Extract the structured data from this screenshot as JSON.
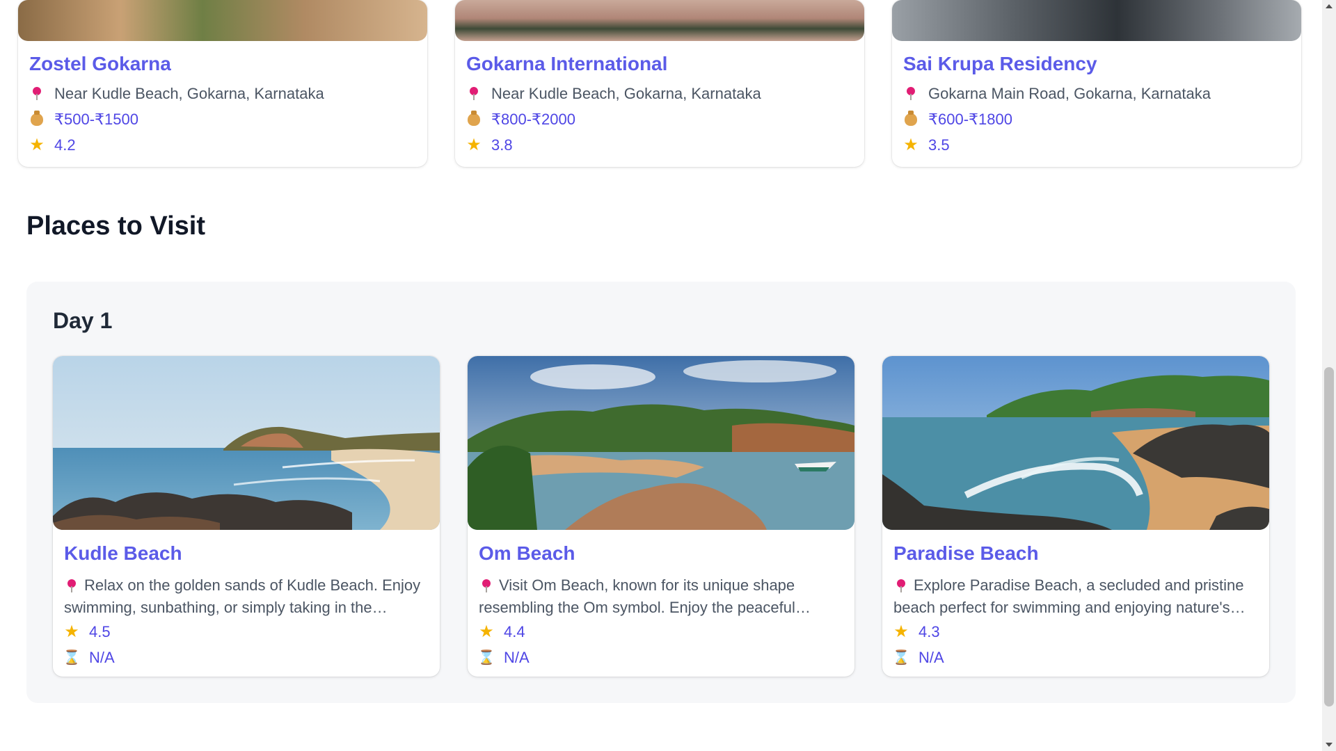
{
  "hotels": [
    {
      "name": "Zostel Gokarna",
      "location": "Near Kudle Beach, Gokarna, Karnataka",
      "price": "₹500-₹1500",
      "rating": "4.2"
    },
    {
      "name": "Gokarna International",
      "location": "Near Kudle Beach, Gokarna, Karnataka",
      "price": "₹800-₹2000",
      "rating": "3.8"
    },
    {
      "name": "Sai Krupa Residency",
      "location": "Gokarna Main Road, Gokarna, Karnataka",
      "price": "₹600-₹1800",
      "rating": "3.5"
    }
  ],
  "places_section_title": "Places to Visit",
  "day": {
    "title": "Day 1",
    "places": [
      {
        "name": "Kudle Beach",
        "description": "Relax on the golden sands of Kudle Beach. Enjoy swimming, sunbathing, or simply taking in the breathtaking views of the Arabian Sea.",
        "rating": "4.5",
        "duration": "N/A"
      },
      {
        "name": "Om Beach",
        "description": "Visit Om Beach, known for its unique shape resembling the Om symbol. Enjoy the peaceful atmosphere and stunning sunset views.",
        "rating": "4.4",
        "duration": "N/A"
      },
      {
        "name": "Paradise Beach",
        "description": "Explore Paradise Beach, a secluded and pristine beach perfect for swimming and enjoying nature's beauty away from the crowds.",
        "rating": "4.3",
        "duration": "N/A"
      }
    ]
  },
  "icons": {
    "location": "pin-icon",
    "price": "money-bag-icon",
    "rating": "star-icon",
    "duration": "hourglass-icon"
  },
  "colors": {
    "accent": "#5b5be8",
    "pin": "#e11d74",
    "star": "#f5b301",
    "panel_bg": "#f6f7f9"
  }
}
